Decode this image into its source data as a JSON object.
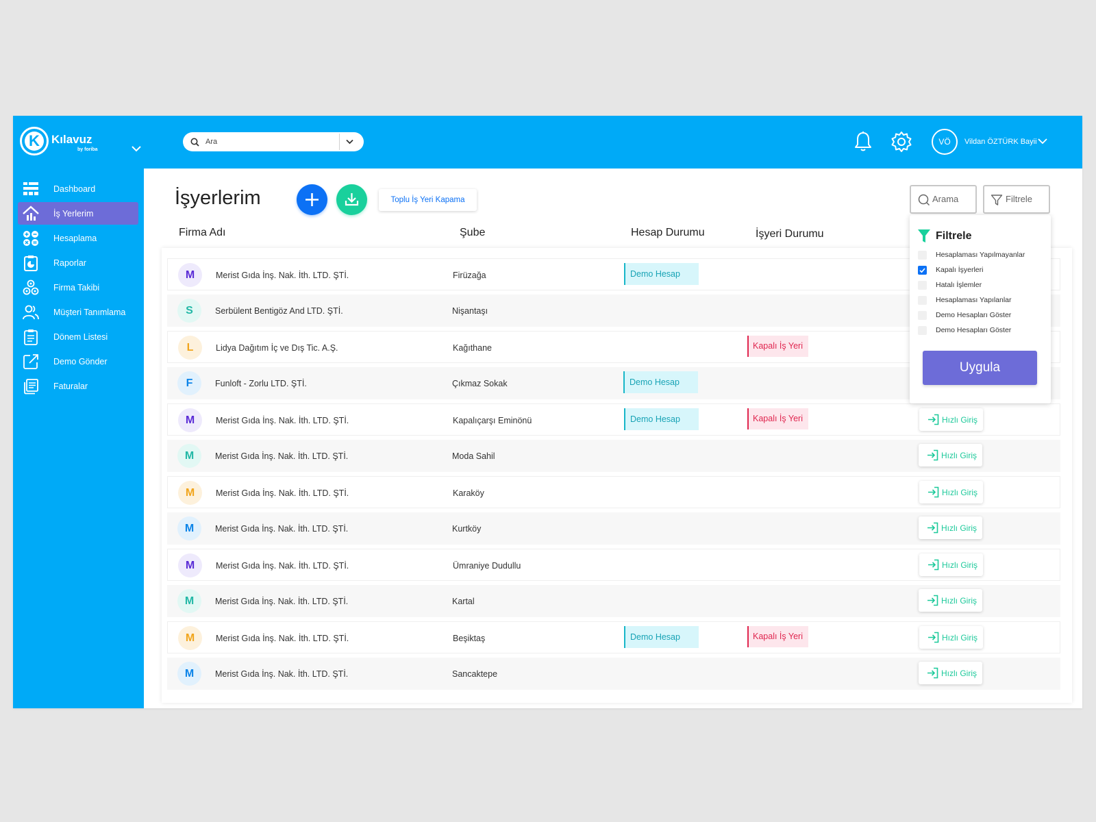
{
  "app": {
    "logo_text": "Kılavuz",
    "logo_sub": "by foriba",
    "logo_letter": "K"
  },
  "search": {
    "placeholder": "Ara"
  },
  "user": {
    "initials": "VÖ",
    "name": "Vildan ÖZTÜRK Bayii"
  },
  "sidebar": {
    "items": [
      {
        "label": "Dashboard",
        "icon": "dashboard-icon"
      },
      {
        "label": "İş Yerlerim",
        "icon": "home-chart-icon",
        "active": true
      },
      {
        "label": "Hesaplama",
        "icon": "calculator-icon"
      },
      {
        "label": "Raporlar",
        "icon": "report-pie-icon"
      },
      {
        "label": "Firma Takibi",
        "icon": "company-tracking-icon"
      },
      {
        "label": "Müşteri Tanımlama",
        "icon": "users-icon"
      },
      {
        "label": "Dönem Listesi",
        "icon": "clipboard-list-icon"
      },
      {
        "label": "Demo Gönder",
        "icon": "share-external-icon"
      },
      {
        "label": "Faturalar",
        "icon": "invoice-icon"
      }
    ]
  },
  "main": {
    "title": "İşyerlerim",
    "bulk_close_label": "Toplu İş Yeri Kapama",
    "search_button": "Arama",
    "filter_button": "Filtrele",
    "columns": {
      "firm": "Firma Adı",
      "branch": "Şube",
      "account_status": "Hesap Durumu",
      "workplace_status": "İşyeri Durumu"
    },
    "badge_demo": "Demo Hesap",
    "badge_closed": "Kapalı İş Yeri",
    "quick_login": "Hızlı Giriş",
    "rows": [
      {
        "initial": "M",
        "firm": "Merist Gıda İnş. Nak. İth. LTD. ŞTİ.",
        "branch": "Firüzağa",
        "demo": true,
        "closed": false,
        "quick": false
      },
      {
        "initial": "S",
        "firm": "Serbülent Bentigöz  And LTD. ŞTİ.",
        "branch": "Nişantaşı",
        "demo": false,
        "closed": false,
        "quick": false
      },
      {
        "initial": "L",
        "firm": "Lidya Dağıtım İç ve Dış Tic. A.Ş.",
        "branch": "Kağıthane",
        "demo": false,
        "closed": true,
        "quick": false
      },
      {
        "initial": "F",
        "firm": "Funloft - Zorlu LTD. ŞTİ.",
        "branch": "Çıkmaz Sokak",
        "demo": true,
        "closed": false,
        "quick": false
      },
      {
        "initial": "M",
        "firm": "Merist Gıda İnş. Nak. İth. LTD. ŞTİ.",
        "branch": "Kapalıçarşı Eminönü",
        "demo": true,
        "closed": true,
        "quick": true
      },
      {
        "initial": "M",
        "firm": "Merist Gıda İnş. Nak. İth. LTD. ŞTİ.",
        "branch": "Moda Sahil",
        "demo": false,
        "closed": false,
        "quick": true
      },
      {
        "initial": "M",
        "firm": "Merist Gıda İnş. Nak. İth. LTD. ŞTİ.",
        "branch": "Karaköy",
        "demo": false,
        "closed": false,
        "quick": true
      },
      {
        "initial": "M",
        "firm": "Merist Gıda İnş. Nak. İth. LTD. ŞTİ.",
        "branch": "Kurtköy",
        "demo": false,
        "closed": false,
        "quick": true
      },
      {
        "initial": "M",
        "firm": "Merist Gıda İnş. Nak. İth. LTD. ŞTİ.",
        "branch": "Ümraniye Dudullu",
        "demo": false,
        "closed": false,
        "quick": true
      },
      {
        "initial": "M",
        "firm": "Merist Gıda İnş. Nak. İth. LTD. ŞTİ.",
        "branch": "Kartal",
        "demo": false,
        "closed": false,
        "quick": true
      },
      {
        "initial": "M",
        "firm": "Merist Gıda İnş. Nak. İth. LTD. ŞTİ.",
        "branch": "Beşiktaş",
        "demo": true,
        "closed": true,
        "quick": true
      },
      {
        "initial": "M",
        "firm": "Merist Gıda İnş. Nak. İth. LTD. ŞTİ.",
        "branch": "Sancaktepe",
        "demo": false,
        "closed": false,
        "quick": true
      }
    ]
  },
  "filter_panel": {
    "title": "Filtrele",
    "options": [
      {
        "label": "Hesaplaması Yapılmayanlar",
        "checked": false
      },
      {
        "label": "Kapalı İşyerleri",
        "checked": true
      },
      {
        "label": "Hatalı İşlemler",
        "checked": false
      },
      {
        "label": "Hesaplaması Yapılanlar",
        "checked": false
      },
      {
        "label": "Demo Hesapları Göster",
        "checked": false
      },
      {
        "label": "Demo Hesapları Göster",
        "checked": false
      }
    ],
    "apply_label": "Uygula"
  },
  "colors": {
    "brand": "#00aaf7",
    "active_nav": "#6d6cd8",
    "primary": "#0c71f5",
    "success": "#19d09c",
    "demo": "#18a3b5",
    "closed": "#e0264f",
    "avatar_palette": {
      "M": {
        "bg": "#eeeafc",
        "fg": "#5a2bd6"
      },
      "S": {
        "bg": "#e2f8f4",
        "fg": "#22b8a6"
      },
      "L": {
        "bg": "#fdf1dc",
        "fg": "#f1a51c"
      },
      "F": {
        "bg": "#e1f1fd",
        "fg": "#0c84e8"
      },
      "M-teal": {
        "bg": "#e2f8f4",
        "fg": "#22b8a6"
      },
      "M-orange": {
        "bg": "#fdf1dc",
        "fg": "#f1a51c"
      },
      "M-blue": {
        "bg": "#e1f1fd",
        "fg": "#0c84e8"
      }
    }
  }
}
